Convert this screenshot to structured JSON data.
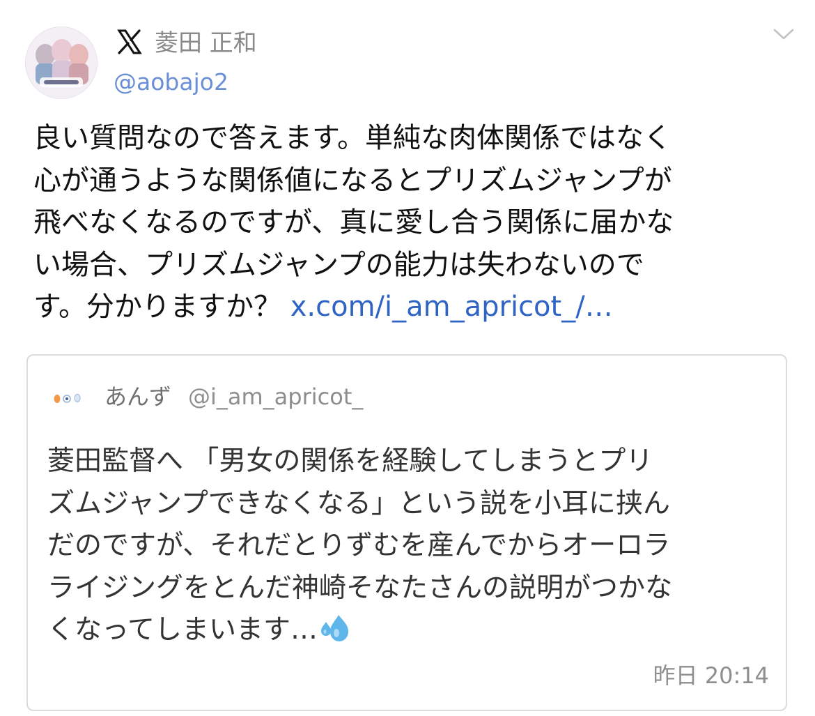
{
  "author": {
    "platform_icon": "x-logo-icon",
    "display_name": "菱田 正和",
    "handle": "@aobajo2"
  },
  "tweet": {
    "lines": [
      "良い質問なので答えます。単純な肉体関係ではなく",
      "心が通うような関係値になるとプリズムジャンプが",
      "飛べなくなるのですが、真に愛し合う関係に届かな",
      "い場合、プリズムジャンプの能力は失わないので"
    ],
    "last_line_text": "す。分かりますか？",
    "link_text": "x.com/i_am_apricot_/…"
  },
  "quoted_tweet": {
    "display_name": "あんず",
    "handle": "@i_am_apricot_",
    "lines": [
      "菱田監督へ 「男女の関係を経験してしまうとプリ",
      "ズムジャンプできなくなる」という説を小耳に挟ん",
      "だのですが、それだとりずむを産んでからオーロラ",
      "ライジングをとんだ神崎そなたさんの説明がつかな"
    ],
    "last_line_text": "くなってしまいます…",
    "last_line_icon": "sweat-droplets-icon",
    "timestamp": "昨日 20:14"
  },
  "colors": {
    "link": "#2f63c4",
    "handle": "#6b8fd6",
    "muted": "#8e8e8e",
    "border": "#dcdcdc"
  }
}
